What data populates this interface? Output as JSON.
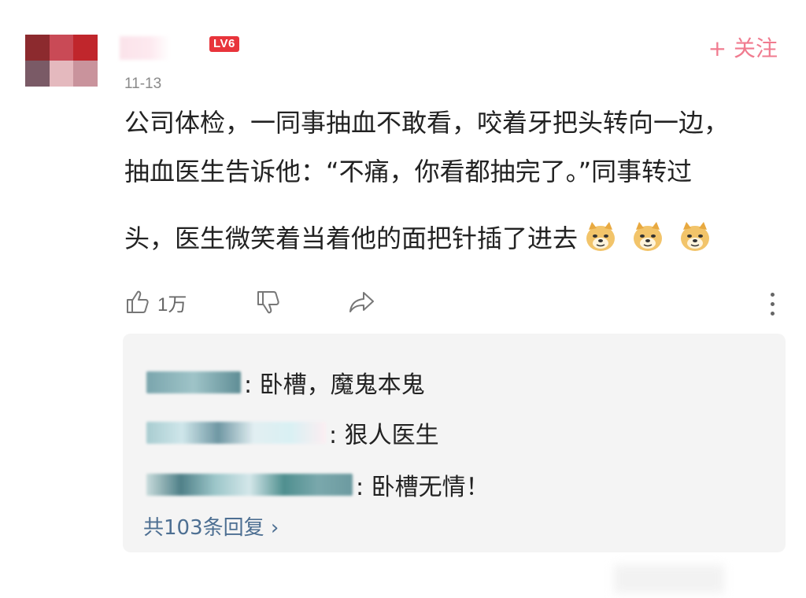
{
  "post": {
    "avatar": {
      "colors": [
        "#8c2a2e",
        "#c94a56",
        "#c0262c",
        "#7a5a66",
        "#e4b9be",
        "#c9939c"
      ]
    },
    "level_badge": "LV6",
    "follow_label": "+ 关注",
    "date": "11-13",
    "content_lines": [
      "公司体检，一同事抽血不敢看，咬着牙把头转向一边，",
      "抽血医生告诉他：“不痛，你看都抽完了。”同事转过",
      "头，医生微笑着当着他的面把针插了进去"
    ],
    "emojis": [
      "doge-emoji",
      "doge-emoji",
      "doge-emoji"
    ],
    "like_count": "1万",
    "icons": {
      "like": "thumbs-up-icon",
      "dislike": "thumbs-down-icon",
      "share": "share-icon",
      "more": "more-vertical-icon"
    }
  },
  "replies": {
    "items": [
      {
        "text": ": 卧槽，魔鬼本鬼"
      },
      {
        "text": ": 狠人医生"
      },
      {
        "text": ": 卧槽无情！"
      }
    ],
    "total_label": "共103条回复",
    "total_chevron": "›"
  },
  "colors": {
    "accent_pink": "#f07b8f",
    "link_blue": "#4d6f92",
    "badge_red": "#e8343b"
  }
}
